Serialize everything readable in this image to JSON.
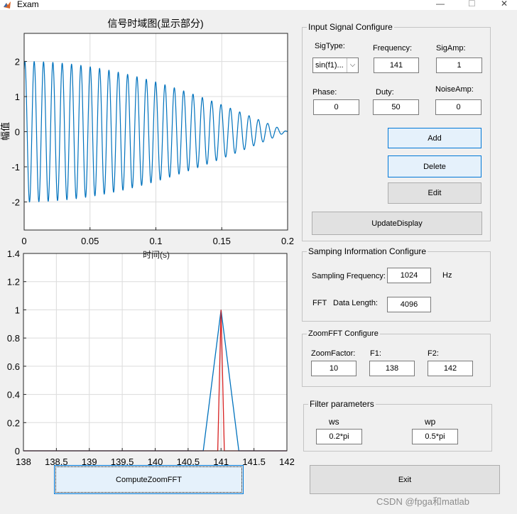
{
  "window": {
    "title": "Exam",
    "minimize_glyph": "—",
    "maximize_glyph": "☐",
    "close_glyph": "✕"
  },
  "plot1": {
    "title": "信号时域图(显示部分)",
    "ylabel": "幅值",
    "xticks": [
      "0",
      "0.05",
      "0.1",
      "0.15",
      "0.2"
    ],
    "yticks": [
      "-2",
      "-1",
      "0",
      "1",
      "2"
    ],
    "xlabel_fragment": "时间(s)"
  },
  "plot2": {
    "xticks": [
      "138",
      "138.5",
      "139",
      "139.5",
      "140",
      "140.5",
      "141",
      "141.5",
      "142"
    ],
    "yticks": [
      "0",
      "0.2",
      "0.4",
      "0.6",
      "0.8",
      "1",
      "1.2",
      "1.4"
    ]
  },
  "chart_data": [
    {
      "type": "line",
      "title": "信号时域图(显示部分)",
      "ylabel": "幅值",
      "xlim": [
        0,
        0.2
      ],
      "ylim": [
        -2.8,
        2.8
      ],
      "grid": true,
      "series": [
        {
          "description": "sum of two sinusoids near 141 Hz, beat envelope",
          "carrier_hz": 141,
          "beat_hz": 2.5,
          "peak_amplitude": 2,
          "color": "#0072bd"
        }
      ]
    },
    {
      "type": "line",
      "xlim": [
        138,
        142
      ],
      "ylim": [
        0,
        1.4
      ],
      "grid": true,
      "series": [
        {
          "x": [
            138,
            140.73,
            141,
            141.27,
            142
          ],
          "y": [
            0,
            0,
            1,
            0,
            0
          ],
          "color": "#0072bd"
        },
        {
          "x": [
            138,
            140.95,
            141,
            141.05,
            142
          ],
          "y": [
            0,
            0,
            1,
            0,
            0
          ],
          "color": "#d62020"
        }
      ]
    }
  ],
  "input_panel": {
    "title": "Input Signal Configure",
    "sigtype_label": "SigType:",
    "sigtype_value": "sin(f1)...",
    "frequency_label": "Frequency:",
    "frequency_value": "141",
    "sigamp_label": "SigAmp:",
    "sigamp_value": "1",
    "phase_label": "Phase:",
    "phase_value": "0",
    "duty_label": "Duty:",
    "duty_value": "50",
    "noiseamp_label": "NoiseAmp:",
    "noiseamp_value": "0",
    "add_label": "Add",
    "delete_label": "Delete",
    "edit_label": "Edit",
    "update_label": "UpdateDisplay"
  },
  "sampling_panel": {
    "title": "Samping Information Configure",
    "freq_label": "Sampling Frequency:",
    "freq_value": "1024",
    "freq_unit": "Hz",
    "fft_label": "FFT",
    "length_label": "Data Length:",
    "length_value": "4096"
  },
  "zoom_panel": {
    "title": "ZoomFFT Configure",
    "factor_label": "ZoomFactor:",
    "factor_value": "10",
    "f1_label": "F1:",
    "f1_value": "138",
    "f2_label": "F2:",
    "f2_value": "142"
  },
  "filter_panel": {
    "title": "Filter parameters",
    "ws_label": "ws",
    "ws_value": "0.2*pi",
    "wp_label": "wp",
    "wp_value": "0.5*pi"
  },
  "compute_label": "ComputeZoomFFT",
  "exit_label": "Exit",
  "watermark": "CSDN @fpga和matlab"
}
